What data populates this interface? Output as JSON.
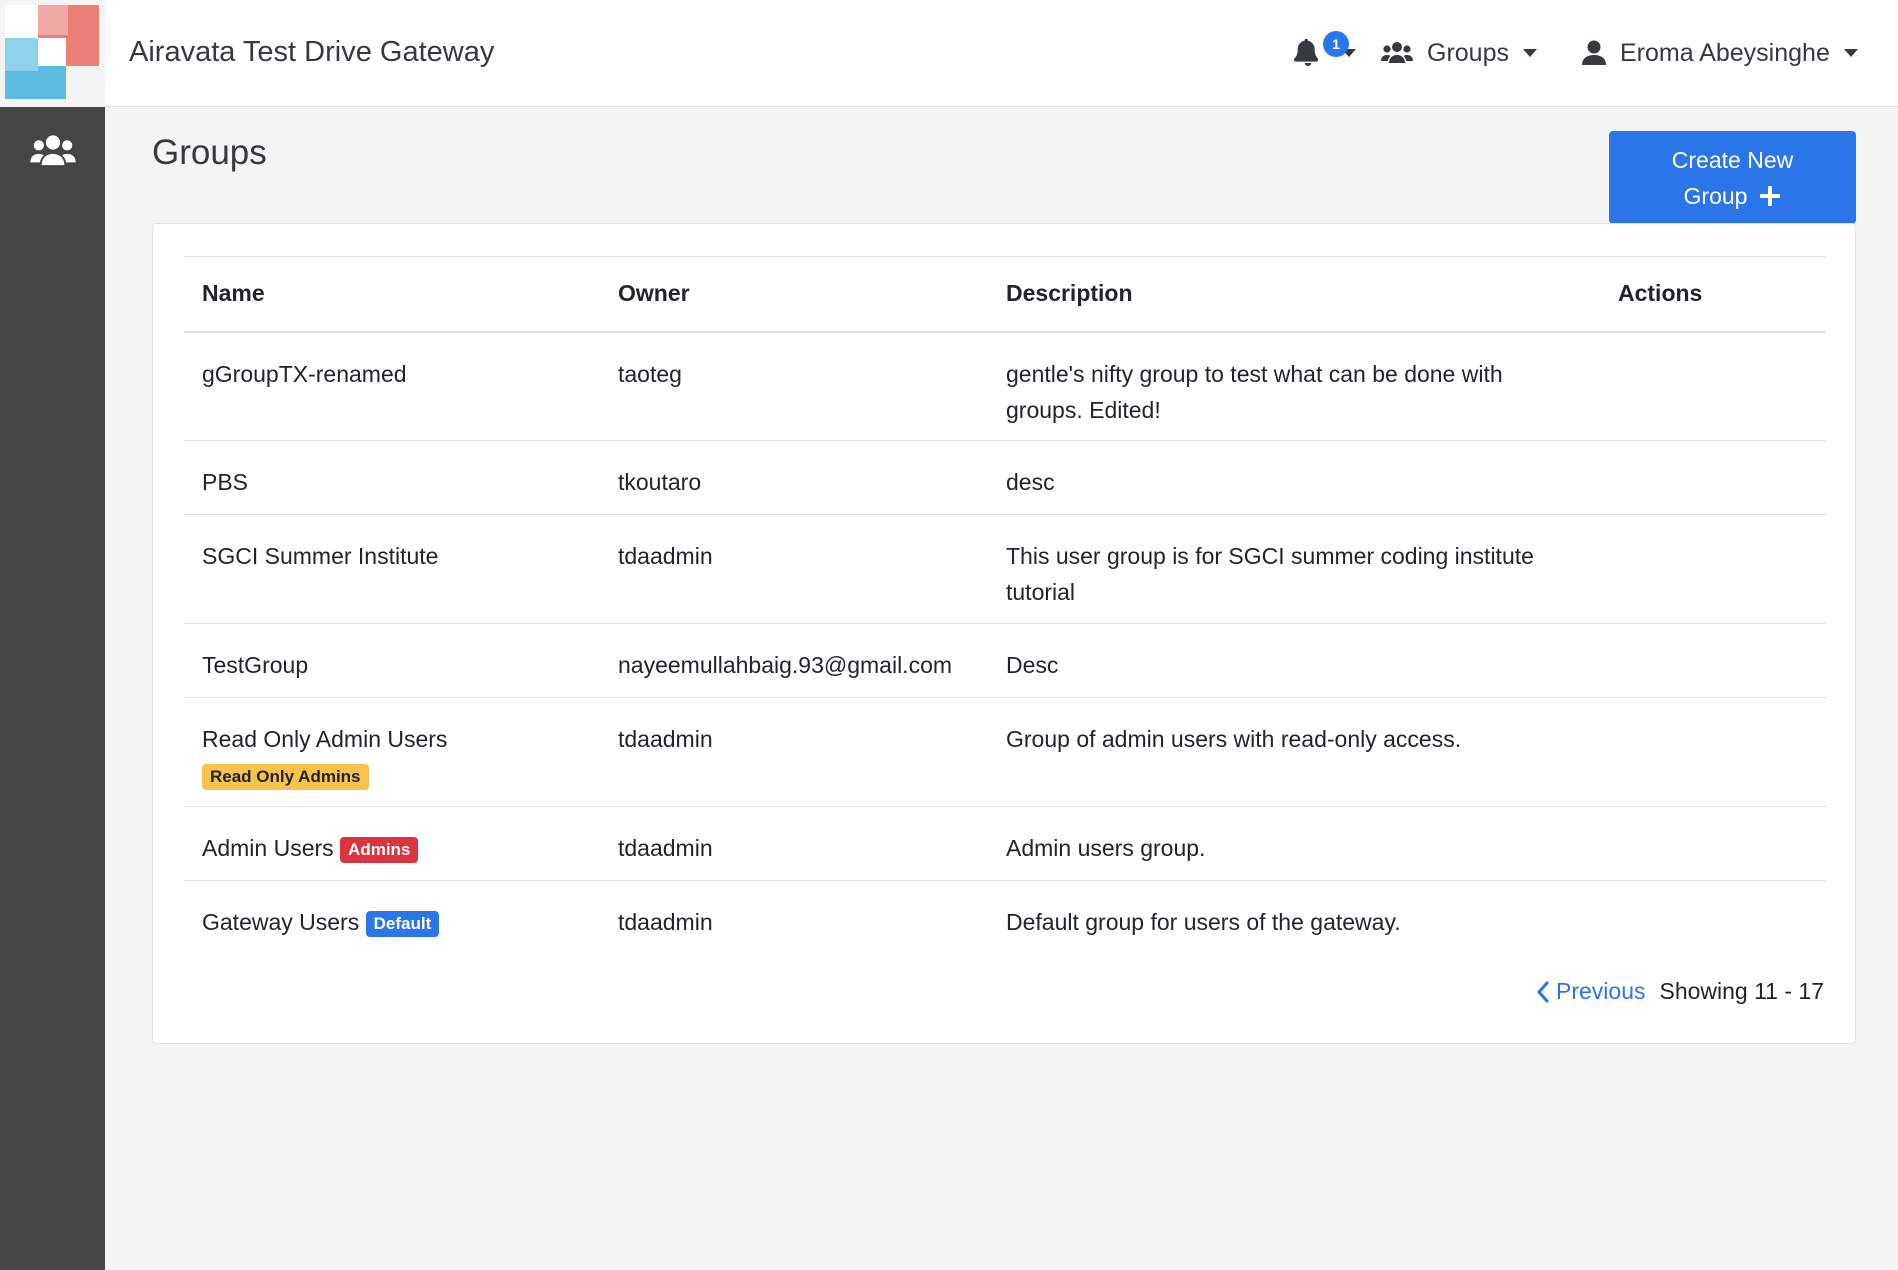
{
  "header": {
    "app_title": "Airavata Test Drive Gateway",
    "notification_count": "1",
    "groups_label": "Groups",
    "user_name": "Eroma Abeysinghe"
  },
  "sidebar": {
    "items": [
      {
        "icon": "users-icon",
        "label": "Groups"
      }
    ]
  },
  "main": {
    "title": "Groups",
    "create_button_line1": "Create New",
    "create_button_line2": "Group"
  },
  "table": {
    "headers": {
      "name": "Name",
      "owner": "Owner",
      "description": "Description",
      "actions": "Actions"
    },
    "rows": [
      {
        "name": "gGroupTX-renamed",
        "badge": "",
        "owner": "taoteg",
        "description": "gentle's nifty group to test what can be done with groups. Edited!"
      },
      {
        "name": "PBS",
        "badge": "",
        "owner": "tkoutaro",
        "description": "desc"
      },
      {
        "name": "SGCI Summer Institute",
        "badge": "",
        "owner": "tdaadmin",
        "description": "This user group is for SGCI summer coding institute tutorial"
      },
      {
        "name": "TestGroup",
        "badge": "",
        "owner": "nayeemullahbaig.93@gmail.com",
        "description": "Desc"
      },
      {
        "name": "Read Only Admin Users",
        "badge": "Read Only Admins",
        "owner": "tdaadmin",
        "description": "Group of admin users with read-only access."
      },
      {
        "name": "Admin Users",
        "badge": "Admins",
        "owner": "tdaadmin",
        "description": "Admin users group."
      },
      {
        "name": "Gateway Users",
        "badge": "Default",
        "owner": "tdaadmin",
        "description": "Default group for users of the gateway."
      }
    ]
  },
  "pagination": {
    "previous_label": "Previous",
    "status": "Showing 11 - 17"
  },
  "colors": {
    "primary": "#2a76e8",
    "sidebar": "#454545",
    "badge_warning": "#f7c34a",
    "badge_danger": "#d9343f"
  }
}
